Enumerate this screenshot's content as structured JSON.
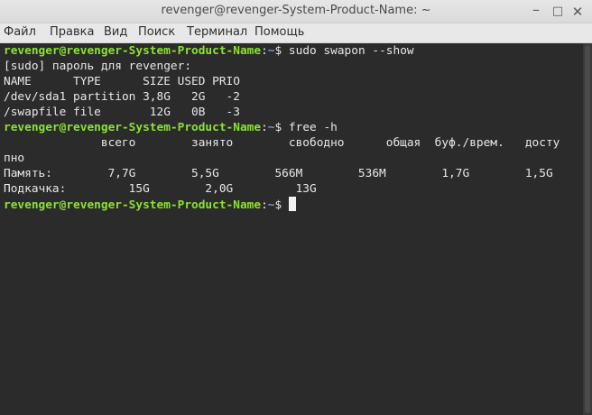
{
  "window": {
    "title": "revenger@revenger-System-Product-Name: ~",
    "minimize_glyph": "–",
    "maximize_glyph": "□",
    "close_glyph": "✕"
  },
  "menu": {
    "items": [
      {
        "label": "Файл"
      },
      {
        "label": "Правка"
      },
      {
        "label": "Вид"
      },
      {
        "label": "Поиск"
      },
      {
        "label": "Терминал"
      },
      {
        "label": "Помощь"
      }
    ]
  },
  "terminal": {
    "user_host": "revenger@revenger-System-Product-Name",
    "colon": ":",
    "cwd": "~",
    "dollar": "$ ",
    "cmd1": "sudo swapon --show",
    "out1": [
      "[sudo] пароль для revenger:",
      "NAME      TYPE      SIZE USED PRIO",
      "/dev/sda1 partition 3,8G   2G   -2",
      "/swapfile file       12G   0B   -3"
    ],
    "cmd2": "free -h",
    "out2": [
      "              всего        занято        свободно      общая  буф./врем.   досту",
      "пно",
      "Память:        7,7G        5,5G        566M        536M        1,7G        1,5G",
      "Подкачка:         15G        2,0G         13G"
    ]
  },
  "colors": {
    "prompt_user": "#8ae234",
    "prompt_path": "#729fcf",
    "terminal_bg": "#2b2b2b",
    "terminal_fg": "#e8e8e8"
  }
}
